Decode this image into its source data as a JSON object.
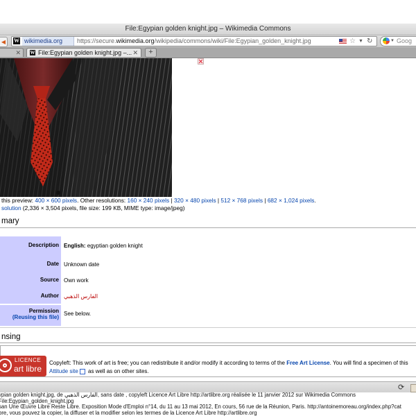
{
  "window": {
    "title": "File:Egypian golden knight.jpg – Wikimedia Commons"
  },
  "navbar": {
    "site_identity": "wikimedia.org",
    "url_prefix": "https://secure.",
    "url_domain": "wikimedia.org",
    "url_path": "/wikipedia/commons/wiki/File:Egypian_golden_knight.jpg",
    "search_placeholder": "Goog"
  },
  "tabs": [
    {
      "label": ""
    },
    {
      "label": "File:Egypian golden knight.jpg –..."
    }
  ],
  "file_info": {
    "preview_size_prefix": "this preview: ",
    "preview_size": "400 × 600 pixels",
    "other_res_label": ". Other resolutions: ",
    "resolutions": [
      "160 × 240 pixels",
      "320 × 480 pixels",
      "512 × 768 pixels",
      "682 × 1,024 pixels"
    ],
    "separator": " | ",
    "trailing": ".",
    "full_res_link": "solution",
    "full_res_details": " (2,336 × 3,504 pixels, file size: 199 KB, MIME type: image/jpeg)"
  },
  "summary": {
    "heading": "mary",
    "rows": [
      {
        "label": "Description",
        "value_bold": "English:",
        "value": " egyptian golden knight"
      },
      {
        "label": "Date",
        "value": "Unknown date"
      },
      {
        "label": "Source",
        "value": "Own work"
      },
      {
        "label": "Author",
        "value": "الفارس الذهبي"
      },
      {
        "label": "Permission",
        "sub_link": "(Reusing this file)",
        "value": "See below."
      }
    ]
  },
  "licensing": {
    "heading": "nsing",
    "logo_top": "LICENCE",
    "logo_bottom": "art libre",
    "text1_prefix": "Copyleft: This work of art is free; you can redistribute it and/or modify it according to terms of the ",
    "text1_link": "Free Art License",
    "text1_suffix": ". You will find a specimen of this",
    "text2_link": "Attitude site",
    "text2_suffix": " as well as on other sites."
  },
  "caption": {
    "line1": "ypian golden knight.jpg, de الفارس الذهبي, sans date , copyleft Licence Art Libre http://artlibre.org réalisée le 11 janvier 2012 sur Wikimedia Commons",
    "line2": "File:Egypian_golden_knight.jpg",
    "line3": "san Une Œuvre Libre Reste Libre. Exposition Mode d'Emploi n°14, du 11 au 13 mai 2012, En cours, 56 rue de la Réunion, Paris. http://antoinemoreau.org/index.php?cat",
    "line4": "bre, vous pouvez la copier, la diffuser et la modifier selon les termes de la Licence Art Libre http://artlibre.org"
  }
}
